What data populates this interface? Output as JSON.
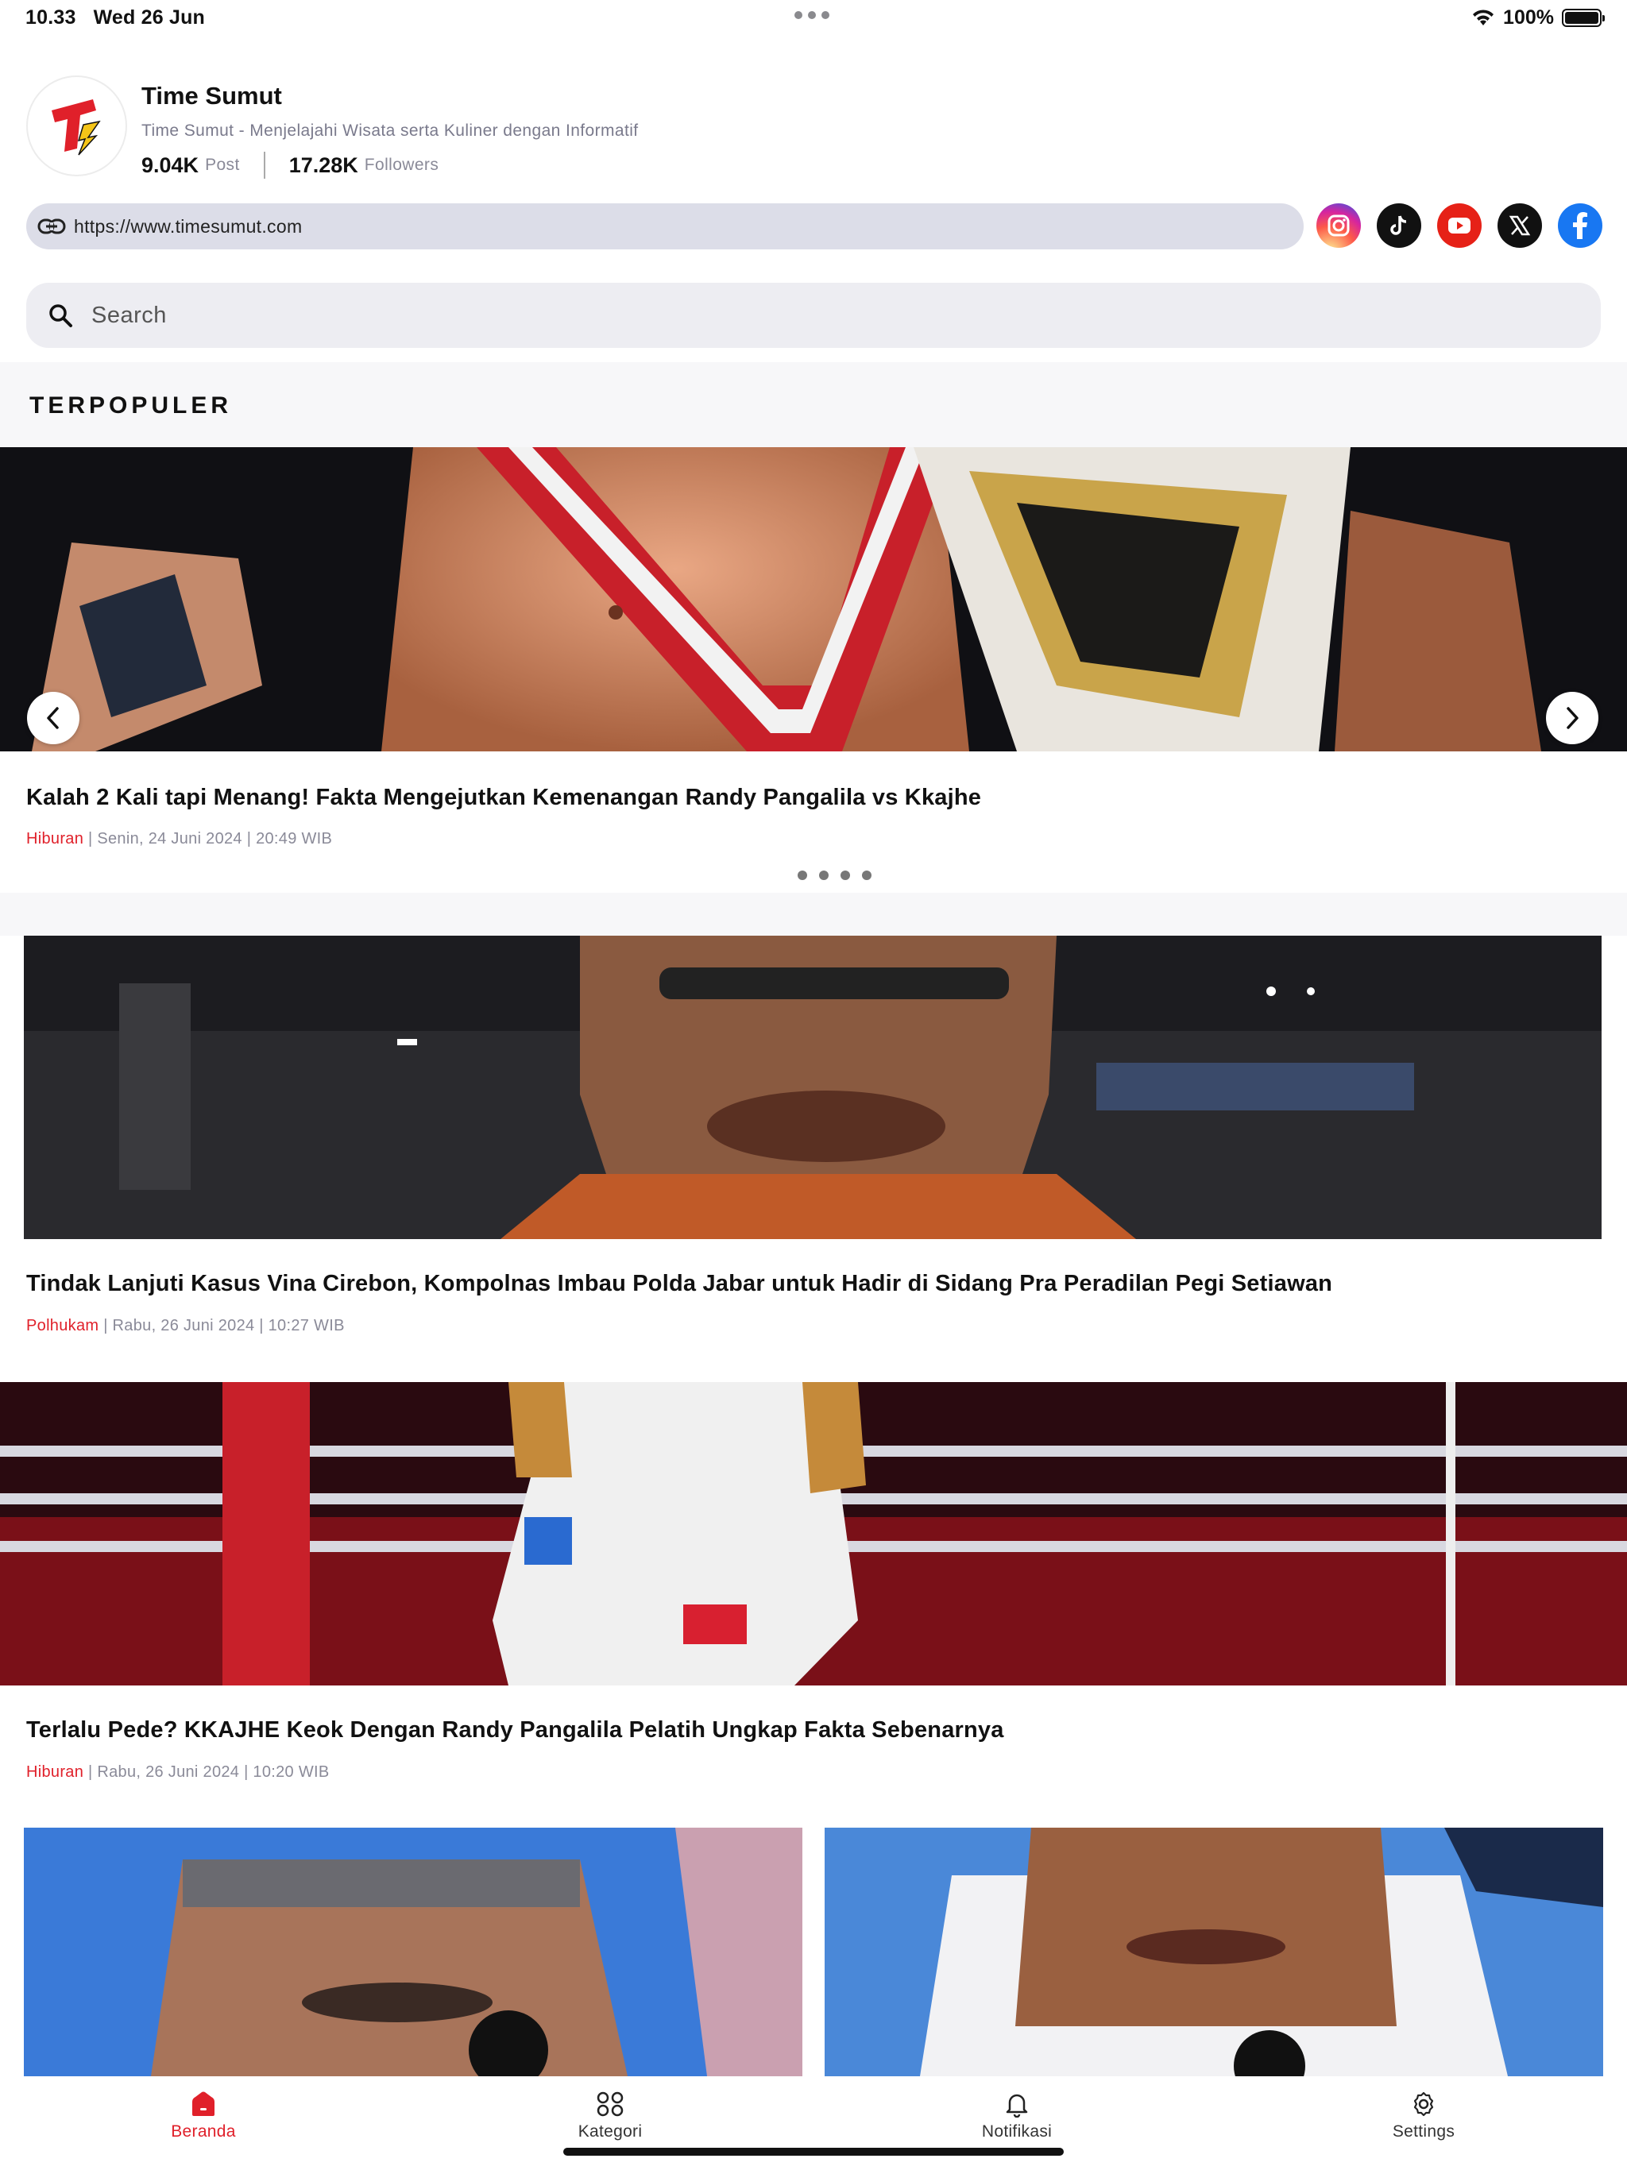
{
  "status": {
    "time": "10.33",
    "date": "Wed 26 Jun",
    "battery": "100%",
    "battery_level": 1.0
  },
  "profile": {
    "name": "Time Sumut",
    "description": "Time Sumut - Menjelajahi Wisata serta Kuliner dengan Informatif",
    "posts_value": "9.04K",
    "posts_label": "Post",
    "followers_value": "17.28K",
    "followers_label": "Followers",
    "url": "https://www.timesumut.com",
    "socials": [
      "instagram-icon",
      "tiktok-icon",
      "youtube-icon",
      "x-icon",
      "facebook-icon"
    ]
  },
  "search": {
    "placeholder": "Search"
  },
  "section": {
    "title": "TERPOPULER"
  },
  "carousel": {
    "title": "Kalah 2 Kali tapi Menang! Fakta Mengejutkan Kemenangan Randy Pangalila vs Kkajhe",
    "category": "Hiburan",
    "date": " | Senin, 24 Juni 2024 | 20:49 WIB",
    "pages": 4
  },
  "articles": [
    {
      "title": "Tindak Lanjuti Kasus Vina Cirebon, Kompolnas Imbau Polda Jabar untuk Hadir di Sidang Pra Peradilan Pegi Setiawan",
      "category": "Polhukam",
      "date": " | Rabu, 26 Juni 2024 | 10:27 WIB"
    },
    {
      "title": "Terlalu Pede? KKAJHE Keok Dengan Randy Pangalila Pelatih Ungkap Fakta Sebenarnya",
      "category": "Hiburan",
      "date": " | Rabu, 26 Juni 2024 | 10:20 WIB"
    }
  ],
  "tabs": [
    {
      "label": "Beranda",
      "icon": "home-icon",
      "active": true
    },
    {
      "label": "Kategori",
      "icon": "grid-icon",
      "active": false
    },
    {
      "label": "Notifikasi",
      "icon": "bell-icon",
      "active": false
    },
    {
      "label": "Settings",
      "icon": "gear-icon",
      "active": false
    }
  ],
  "colors": {
    "accent": "#e0202a",
    "link_bar": "#dcdde8",
    "search_bg": "#ededf2"
  }
}
